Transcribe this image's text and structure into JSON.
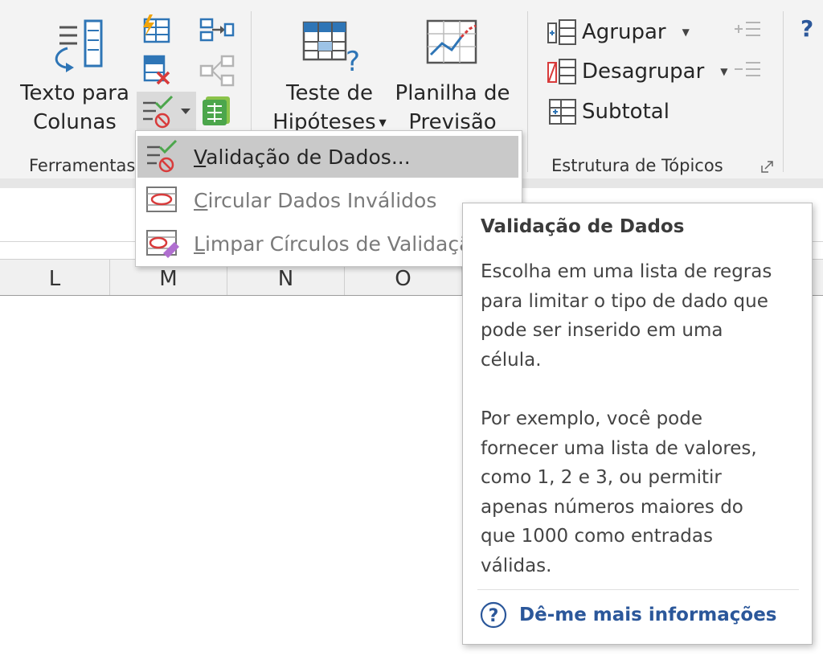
{
  "ribbon": {
    "data_tools": {
      "text_to_columns_line1": "Texto para",
      "text_to_columns_line2": "Colunas",
      "group_label": "Ferramentas"
    },
    "forecast": {
      "what_if_line1": "Teste de",
      "what_if_line2": "Hipóteses",
      "forecast_line1": "Planilha de",
      "forecast_line2": "Previsão"
    },
    "outline": {
      "group": "Agrupar",
      "ungroup": "Desagrupar",
      "subtotal": "Subtotal",
      "group_label": "Estrutura de Tópicos"
    },
    "help_glyph": "?"
  },
  "dropdown": {
    "items": [
      {
        "accel": "V",
        "rest": "alidação de Dados..."
      },
      {
        "accel": "C",
        "rest": "ircular Dados Inválidos"
      },
      {
        "accel": "L",
        "rest": "impar Círculos de Validação"
      }
    ]
  },
  "grid": {
    "columns": [
      "L",
      "M",
      "N",
      "O"
    ]
  },
  "tooltip": {
    "title": "Validação de Dados",
    "paragraph1": [
      "Escolha em uma lista de regras",
      "para limitar o tipo de dado que",
      "pode ser inserido em uma",
      "célula."
    ],
    "paragraph2": [
      "Por exemplo, você pode",
      "fornecer uma lista de valores,",
      "como 1, 2 e 3, ou permitir",
      "apenas números maiores do",
      "que 1000 como entradas",
      "válidas."
    ],
    "link": "Dê-me mais informações"
  },
  "colors": {
    "accent_blue": "#2b579a",
    "icon_blue": "#2e75b6",
    "icon_green": "#4ca64c",
    "icon_red": "#d83b3b",
    "menu_highlight": "#c9c9c9"
  }
}
